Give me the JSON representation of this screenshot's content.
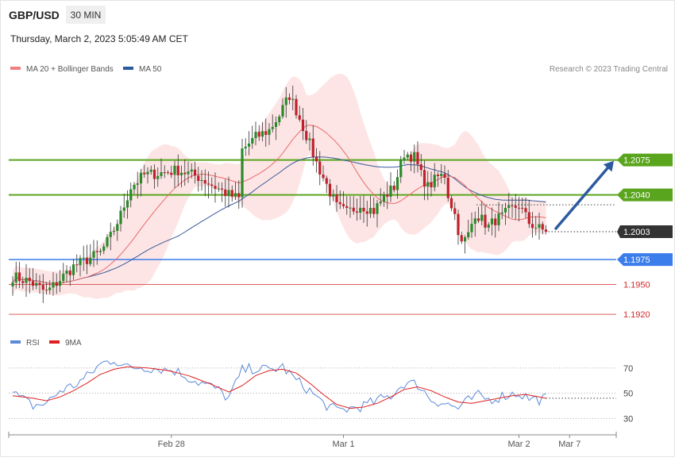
{
  "header": {
    "symbol": "GBP/USD",
    "timeframe": "30 MIN",
    "timestamp": "Thursday, March 2, 2023 5:05:49 AM CET",
    "research": "Research © 2023 Trading Central"
  },
  "colors": {
    "candle_up": "#2a8a2a",
    "candle_down": "#c0202a",
    "bollinger_fill": "#fde0e0",
    "ma20": "#e86a6a",
    "ma50": "#3a5a9a",
    "resistance": "#5aa51e",
    "support": "#3b7dea",
    "support_red": "#e05a5a",
    "current_price": "#333333",
    "rsi": "#5b8ad8",
    "rsi_ma": "#e02020",
    "arrow": "#2d5aa0"
  },
  "chart_data": [
    {
      "type": "candlestick",
      "legend": [
        {
          "label": "MA 20 + Bollinger Bands",
          "color": "#f08080"
        },
        {
          "label": "MA 50",
          "color": "#3a5a9a"
        }
      ],
      "ylim": [
        1.1905,
        1.216
      ],
      "x_labels": [
        {
          "label": "Feb 28",
          "index": 47
        },
        {
          "label": "Mar 1",
          "index": 98
        },
        {
          "label": "Mar 2",
          "index": 150
        },
        {
          "label": "Mar 7",
          "index": 165
        }
      ],
      "x_count": 175,
      "levels": [
        {
          "value": 1.2075,
          "label": "1.2075",
          "kind": "resistance"
        },
        {
          "value": 1.204,
          "label": "1.2040",
          "kind": "resistance"
        },
        {
          "value": 1.2003,
          "label": "1.2003",
          "kind": "current"
        },
        {
          "value": 1.1975,
          "label": "1.1975",
          "kind": "support"
        },
        {
          "value": 1.195,
          "label": "1.1950",
          "kind": "support-minor"
        },
        {
          "value": 1.192,
          "label": "1.1920",
          "kind": "support-minor"
        }
      ],
      "forecast_arrow": {
        "from_index": 160,
        "from_value": 1.2003,
        "to_index": 174,
        "to_value": 1.2075
      },
      "close_anchors": [
        [
          0,
          1.1958
        ],
        [
          5,
          1.1953
        ],
        [
          10,
          1.1942
        ],
        [
          14,
          1.1955
        ],
        [
          18,
          1.1968
        ],
        [
          22,
          1.1975
        ],
        [
          26,
          1.1982
        ],
        [
          29,
          1.1998
        ],
        [
          32,
          1.202
        ],
        [
          35,
          1.2048
        ],
        [
          39,
          1.206
        ],
        [
          44,
          1.2062
        ],
        [
          49,
          1.2065
        ],
        [
          55,
          1.2058
        ],
        [
          60,
          1.2048
        ],
        [
          64,
          1.204
        ],
        [
          67,
          1.2036
        ],
        [
          68,
          1.2085
        ],
        [
          72,
          1.2098
        ],
        [
          76,
          1.2105
        ],
        [
          79,
          1.212
        ],
        [
          82,
          1.214
        ],
        [
          84,
          1.2125
        ],
        [
          87,
          1.21
        ],
        [
          90,
          1.2072
        ],
        [
          93,
          1.205
        ],
        [
          96,
          1.2028
        ],
        [
          99,
          1.2022
        ],
        [
          103,
          1.203
        ],
        [
          107,
          1.2024
        ],
        [
          110,
          1.2038
        ],
        [
          113,
          1.2048
        ],
        [
          116,
          1.2082
        ],
        [
          119,
          1.2078
        ],
        [
          121,
          1.206
        ],
        [
          123,
          1.2048
        ],
        [
          126,
          1.2058
        ],
        [
          128,
          1.206
        ],
        [
          129,
          1.204
        ],
        [
          131,
          1.202
        ],
        [
          133,
          1.199
        ],
        [
          135,
          1.2
        ],
        [
          137,
          1.2022
        ],
        [
          139,
          1.2015
        ],
        [
          141,
          1.2008
        ],
        [
          143,
          1.2015
        ],
        [
          145,
          1.2018
        ],
        [
          147,
          1.2024
        ],
        [
          150,
          1.203
        ],
        [
          153,
          1.2012
        ],
        [
          156,
          1.2006
        ],
        [
          158,
          1.2003
        ]
      ]
    },
    {
      "type": "line",
      "legend": [
        {
          "label": "RSI",
          "color": "#5b8ad8"
        },
        {
          "label": "9MA",
          "color": "#e02020"
        }
      ],
      "ylim": [
        22,
        85
      ],
      "y_ticks": [
        70,
        50,
        30
      ],
      "rsi_anchors": [
        [
          0,
          50
        ],
        [
          6,
          40
        ],
        [
          10,
          42
        ],
        [
          14,
          52
        ],
        [
          18,
          56
        ],
        [
          22,
          63
        ],
        [
          26,
          73
        ],
        [
          30,
          77
        ],
        [
          34,
          70
        ],
        [
          38,
          71
        ],
        [
          42,
          70
        ],
        [
          48,
          68
        ],
        [
          54,
          60
        ],
        [
          60,
          54
        ],
        [
          64,
          46
        ],
        [
          68,
          68
        ],
        [
          72,
          70
        ],
        [
          76,
          68
        ],
        [
          80,
          71
        ],
        [
          84,
          60
        ],
        [
          88,
          52
        ],
        [
          92,
          42
        ],
        [
          96,
          36
        ],
        [
          100,
          38
        ],
        [
          104,
          40
        ],
        [
          108,
          44
        ],
        [
          112,
          48
        ],
        [
          116,
          58
        ],
        [
          120,
          57
        ],
        [
          124,
          45
        ],
        [
          128,
          42
        ],
        [
          132,
          38
        ],
        [
          135,
          44
        ],
        [
          138,
          48
        ],
        [
          141,
          45
        ],
        [
          144,
          47
        ],
        [
          147,
          49
        ],
        [
          150,
          50
        ],
        [
          153,
          46
        ],
        [
          156,
          45
        ],
        [
          158,
          46
        ]
      ],
      "ma_anchors": [
        [
          0,
          48
        ],
        [
          6,
          46
        ],
        [
          10,
          44
        ],
        [
          14,
          47
        ],
        [
          18,
          52
        ],
        [
          22,
          58
        ],
        [
          26,
          65
        ],
        [
          30,
          69
        ],
        [
          34,
          71
        ],
        [
          40,
          70
        ],
        [
          46,
          68
        ],
        [
          52,
          64
        ],
        [
          58,
          58
        ],
        [
          64,
          51
        ],
        [
          68,
          56
        ],
        [
          72,
          64
        ],
        [
          76,
          68
        ],
        [
          80,
          69
        ],
        [
          84,
          66
        ],
        [
          88,
          58
        ],
        [
          92,
          49
        ],
        [
          96,
          41
        ],
        [
          100,
          38
        ],
        [
          104,
          39
        ],
        [
          108,
          42
        ],
        [
          112,
          47
        ],
        [
          116,
          53
        ],
        [
          120,
          55
        ],
        [
          124,
          52
        ],
        [
          128,
          47
        ],
        [
          132,
          43
        ],
        [
          136,
          42
        ],
        [
          140,
          44
        ],
        [
          144,
          46
        ],
        [
          148,
          48
        ],
        [
          152,
          49
        ],
        [
          156,
          47
        ],
        [
          158,
          46
        ]
      ]
    }
  ]
}
